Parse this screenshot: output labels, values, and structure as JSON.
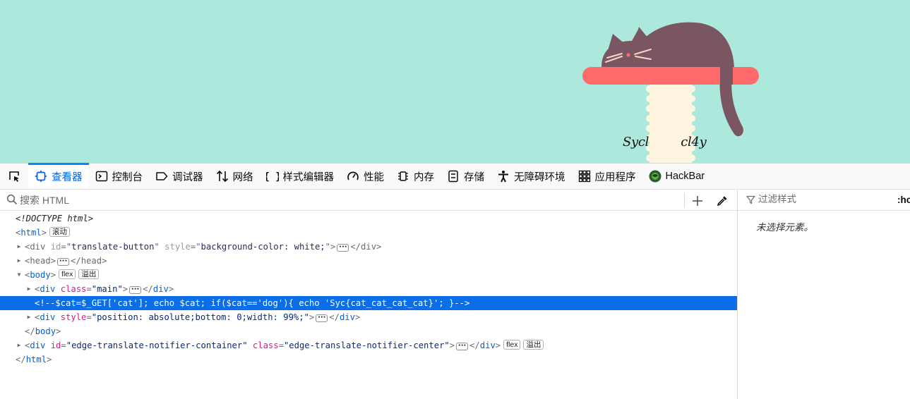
{
  "page": {
    "caption": "Sycl        cl4y",
    "background_color": "#ade8dc"
  },
  "toolbar": {
    "picker_icon": "element-picker-icon",
    "tabs": [
      {
        "label": "查看器",
        "icon": "inspector-icon",
        "selected": true
      },
      {
        "label": "控制台",
        "icon": "console-icon"
      },
      {
        "label": "调试器",
        "icon": "debugger-icon"
      },
      {
        "label": "网络",
        "icon": "network-icon"
      },
      {
        "label": "样式编辑器",
        "icon": "style-editor-icon"
      },
      {
        "label": "性能",
        "icon": "performance-icon"
      },
      {
        "label": "内存",
        "icon": "memory-icon"
      },
      {
        "label": "存储",
        "icon": "storage-icon"
      },
      {
        "label": "无障碍环境",
        "icon": "accessibility-icon"
      },
      {
        "label": "应用程序",
        "icon": "application-icon"
      },
      {
        "label": "HackBar",
        "icon": "hackbar-icon"
      }
    ]
  },
  "markup": {
    "search_placeholder": "搜索 HTML",
    "rows": {
      "doctype": "<!DOCTYPE html>",
      "html_open": "html",
      "html_badge": "滚动",
      "div1_tag": "div",
      "div1_attr": "id",
      "div1_val": "translate-button",
      "div1_attr2": "style",
      "div1_val2": "background-color: white;",
      "head_tag": "head",
      "body_tag": "body",
      "body_badge1": "flex",
      "body_badge2": "溢出",
      "main_tag": "div",
      "main_attr": "class",
      "main_val": "main",
      "comment": "<!--$cat=$_GET['cat']; echo $cat; if($cat=='dog'){ echo 'Syc{cat_cat_cat_cat}'; }-->",
      "div3_tag": "div",
      "div3_attr": "style",
      "div3_val": "position: absolute;bottom: 0;width: 99%;",
      "body_close": "body",
      "div4_tag": "div",
      "div4_attr": "id",
      "div4_val": "edge-translate-notifier-container",
      "div4_attr2": "class",
      "div4_val2": "edge-translate-notifier-center",
      "div4_badge1": "flex",
      "div4_badge2": "溢出",
      "html_close": "html"
    }
  },
  "rules": {
    "filter_placeholder": "过滤样式",
    "hov_label": ":hov",
    "empty_message": "未选择元素。"
  },
  "colors": {
    "accent": "#0a84ff",
    "selection": "#0a6ee8",
    "cat": "#7a5562",
    "perch": "#ff6b6b",
    "post": "#fdf5df"
  }
}
